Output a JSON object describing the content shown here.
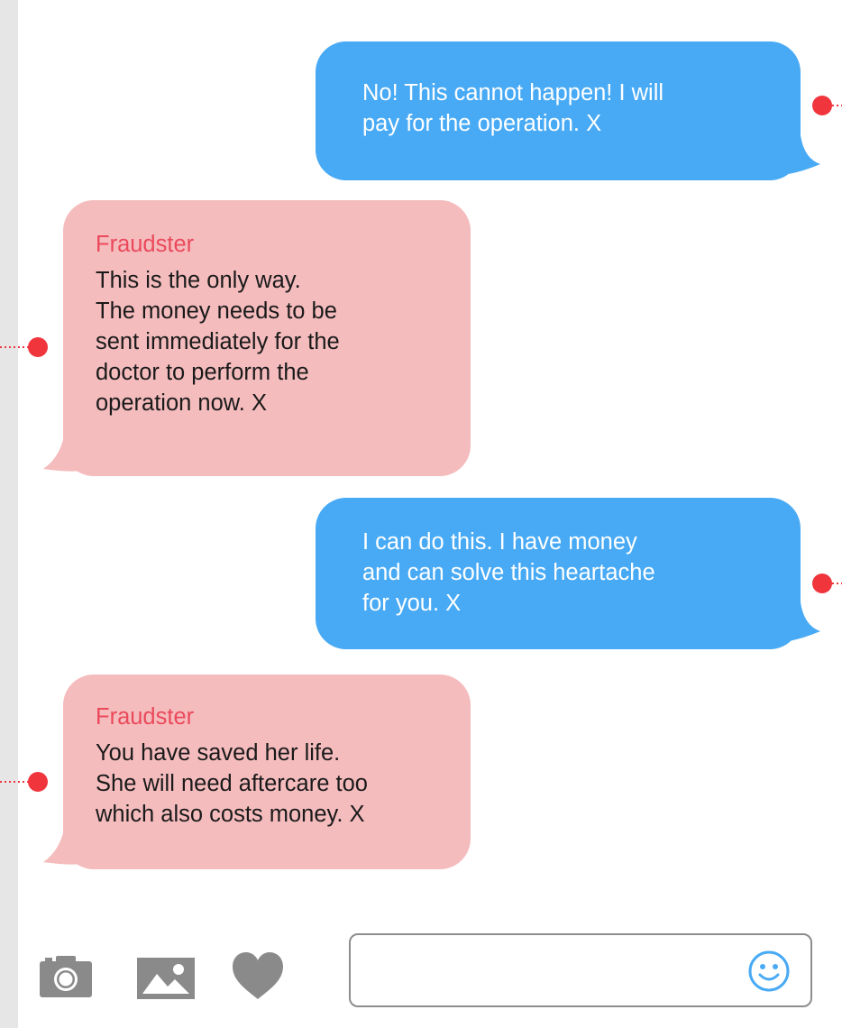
{
  "conversation": {
    "messages": [
      {
        "direction": "outgoing",
        "text_lines": [
          "No! This cannot happen! I will",
          "pay for the operation. X"
        ]
      },
      {
        "direction": "incoming",
        "sender": "Fraudster",
        "text_lines": [
          "This is the only way.",
          "The money needs to be",
          "sent immediately for the",
          "doctor to perform the",
          "operation now. X"
        ]
      },
      {
        "direction": "outgoing",
        "text_lines": [
          "I can do this. I have money",
          "and can solve this heartache",
          "for you. X"
        ]
      },
      {
        "direction": "incoming",
        "sender": "Fraudster",
        "text_lines": [
          "You have saved her life.",
          "She will need aftercare too",
          "which also costs money. X"
        ]
      }
    ]
  },
  "toolbar": {
    "icons": [
      "camera-icon",
      "image-icon",
      "heart-icon"
    ]
  },
  "composer": {
    "value": "",
    "placeholder": "",
    "emoji_icon": "smiley-face-icon"
  },
  "colors": {
    "outgoing_bubble": "#48aaf5",
    "incoming_bubble": "#f5bcbe",
    "sender_name": "#ea4a5b",
    "marker": "#f0353d",
    "toolbar_icon": "#8a8a8a",
    "emoji": "#48aaf5"
  }
}
